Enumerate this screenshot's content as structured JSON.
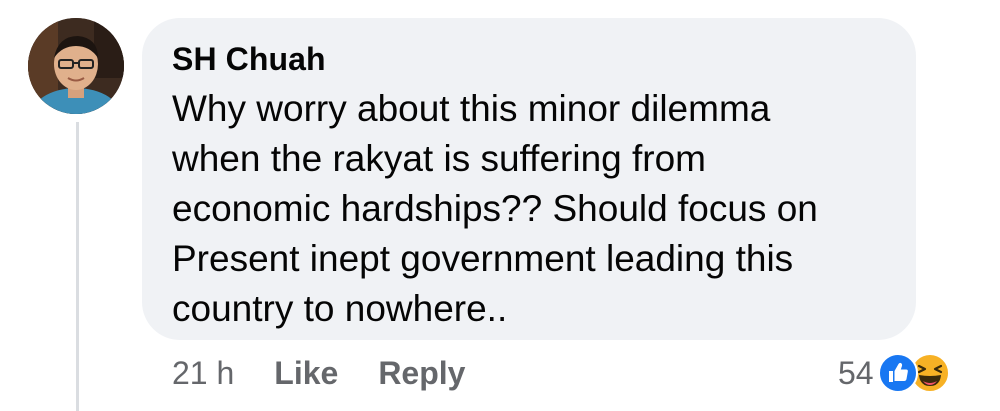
{
  "comment": {
    "author": "SH Chuah",
    "text_lines": [
      "Why worry about this minor dilemma",
      "when the rakyat is suffering from",
      "economic hardships?? Should focus on",
      "Present inept government leading this",
      "country to nowhere.."
    ],
    "timestamp": "21 h",
    "like_label": "Like",
    "reply_label": "Reply",
    "reaction_count": "54",
    "reaction_types": [
      "like-icon",
      "haha-icon"
    ]
  },
  "colors": {
    "bubble_bg": "#f0f2f5",
    "text": "#050505",
    "secondary_text": "#65676b",
    "like_blue": "#1877f2",
    "haha_yellow": "#f7b125"
  }
}
